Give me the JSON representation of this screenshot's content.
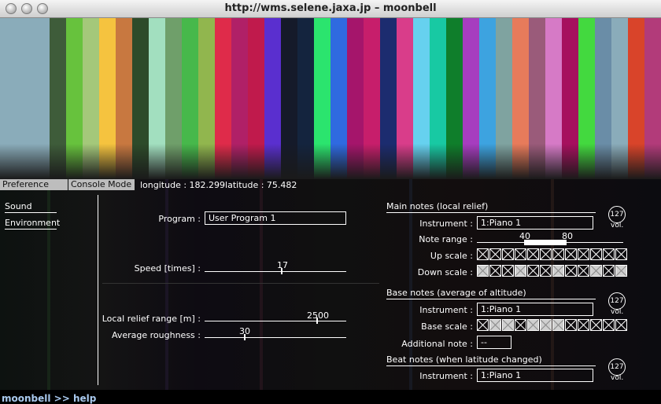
{
  "window": {
    "title": "http://wms.selene.jaxa.jp – moonbell"
  },
  "stripe_colors": [
    "#8aacba",
    "#8aacba",
    "#8aacba",
    "#3e5c3a",
    "#67c23d",
    "#a4c87a",
    "#f5c33f",
    "#c87840",
    "#2d4b2a",
    "#a2dfbf",
    "#6f9f6a",
    "#47b84b",
    "#91b64e",
    "#df2b4a",
    "#b02067",
    "#c01a4c",
    "#5a2fcf",
    "#151a2a",
    "#14243e",
    "#2be46e",
    "#2f6ae0",
    "#a5156b",
    "#c71e6b",
    "#1c2c6f",
    "#d93d8a",
    "#66d1ef",
    "#18c9a3",
    "#0f7e2b",
    "#a63dbf",
    "#3da3e0",
    "#7fa3a0",
    "#e77b5b",
    "#9a5b7a",
    "#d67ac6",
    "#a6105e",
    "#43d93f",
    "#6a8da7",
    "#8aacba",
    "#d9442a",
    "#b23b7a"
  ],
  "tabs": {
    "preference": "Preference",
    "console_mode": "Console Mode"
  },
  "status": {
    "longitude": "longitude : 182.299",
    "latitude": "latitude : 75.482"
  },
  "nav": {
    "sound": "Sound",
    "environment": "Environment"
  },
  "left": {
    "program_label": "Program :",
    "program_value": "User Program 1",
    "speed_label": "Speed [times] :",
    "speed_value": "17",
    "relief_label": "Local relief range [m] :",
    "relief_value": "2500",
    "roughness_label": "Average roughness :",
    "roughness_value": "30"
  },
  "main_notes": {
    "title": "Main notes (local relief)",
    "instrument_label": "Instrument :",
    "instrument_value": "1:Piano 1",
    "note_range_label": "Note range :",
    "note_range_low": "40",
    "note_range_high": "80",
    "up_scale_label": "Up scale :",
    "down_scale_label": "Down scale :",
    "vol_value": "127",
    "vol_label": "vol."
  },
  "base_notes": {
    "title": "Base notes (average of altitude)",
    "instrument_label": "Instrument :",
    "instrument_value": "1:Piano 1",
    "base_scale_label": "Base scale :",
    "additional_note_label": "Additional note :",
    "additional_note_value": "--",
    "vol_value": "127",
    "vol_label": "vol."
  },
  "beat_notes": {
    "title": "Beat notes (when latitude changed)",
    "instrument_label": "Instrument :",
    "instrument_value": "1:Piano 1",
    "vol_value": "127",
    "vol_label": "vol."
  },
  "scales": {
    "up": [
      0,
      0,
      0,
      0,
      0,
      0,
      0,
      0,
      0,
      0,
      0,
      0
    ],
    "down": [
      1,
      0,
      0,
      1,
      0,
      0,
      1,
      0,
      0,
      1,
      0,
      1
    ],
    "base": [
      0,
      1,
      1,
      0,
      1,
      1,
      1,
      0,
      0,
      0,
      0,
      0
    ]
  },
  "console": {
    "text": "moonbell >> help"
  }
}
